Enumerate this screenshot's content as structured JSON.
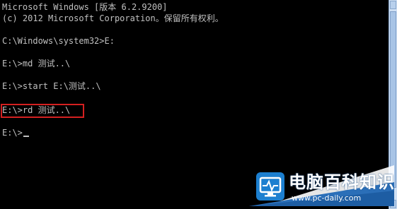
{
  "console": {
    "lines": [
      "Microsoft Windows [版本 6.2.9200]",
      "(c) 2012 Microsoft Corporation。保留所有权利。",
      "C:\\Windows\\system32>E:",
      "E:\\>md 测试..\\",
      "E:\\>start E:\\测试..\\",
      "E:\\>rd 测试..\\",
      "E:\\>"
    ]
  },
  "colors": {
    "background": "#000000",
    "text": "#c0c0c0",
    "highlight_border": "#d42020",
    "brand_blue": "#1c7fd0"
  },
  "watermark": {
    "name": "电脑百科知识",
    "url": "www.pc-daily.com",
    "logo_icon": "monitor-pulse-icon"
  }
}
